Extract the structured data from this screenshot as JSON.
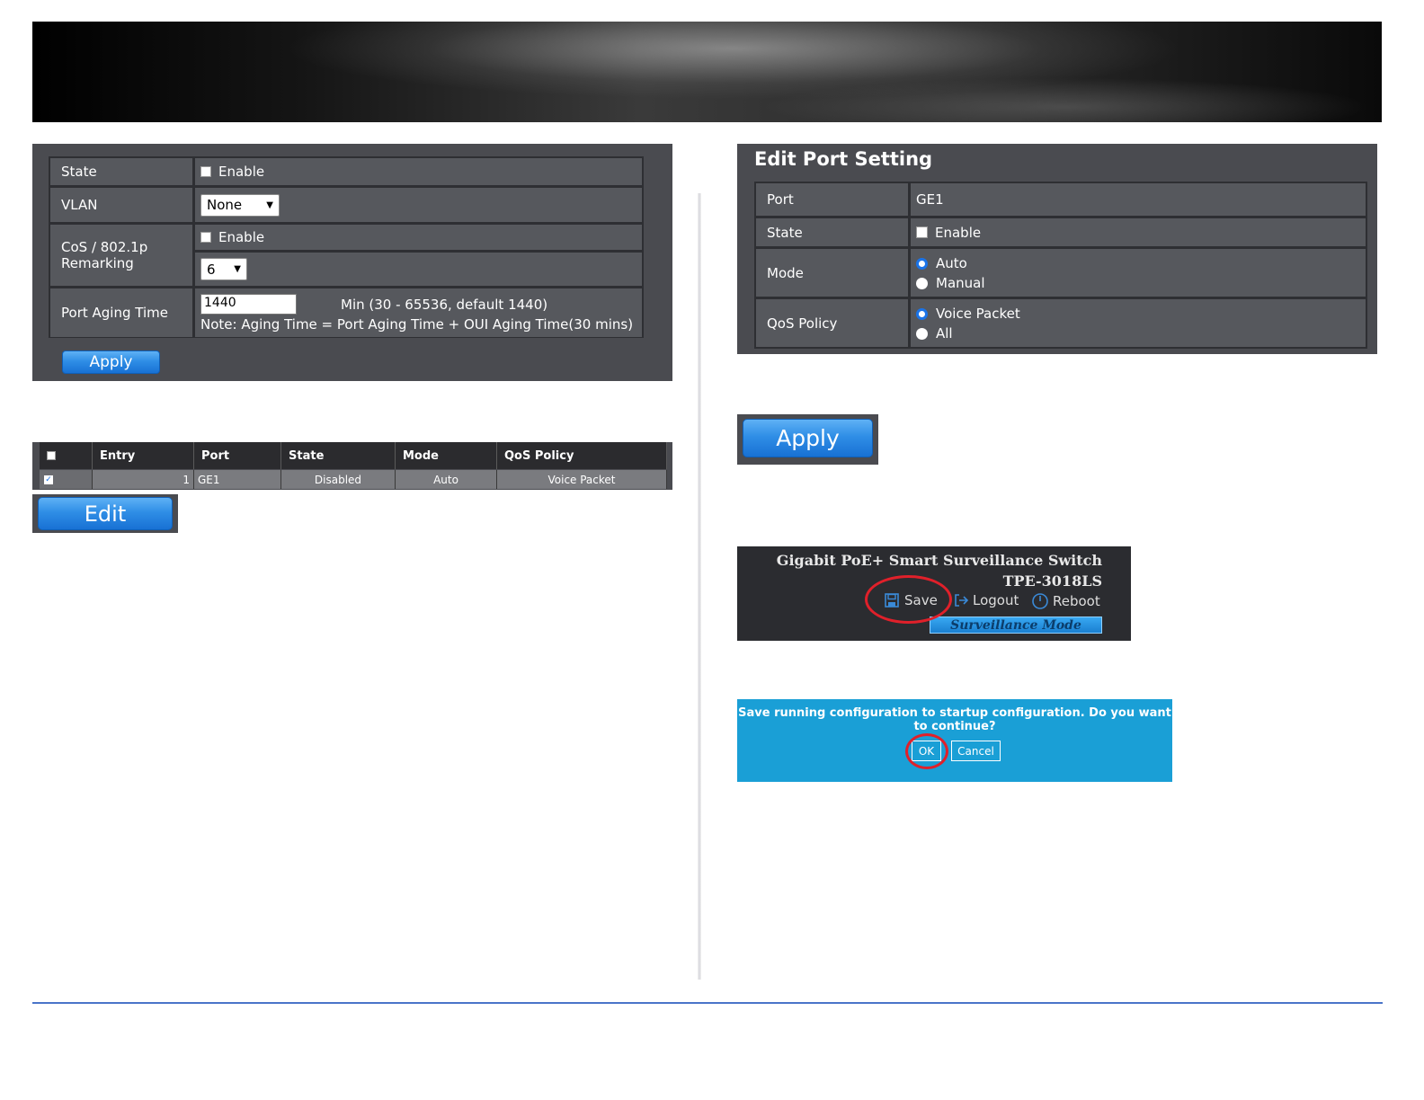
{
  "panel_settings": {
    "state_label": "State",
    "state_enable": "Enable",
    "vlan_label": "VLAN",
    "vlan_value": "None",
    "cos_label_line1": "CoS / 802.1p",
    "cos_label_line2": "Remarking",
    "cos_enable": "Enable",
    "cos_value": "6",
    "aging_label": "Port Aging Time",
    "aging_value": "1440",
    "aging_range": "Min (30 - 65536, default 1440)",
    "aging_note": "Note: Aging Time = Port Aging Time + OUI Aging Time(30 mins)",
    "apply_label": "Apply"
  },
  "port_table": {
    "headers": [
      "Entry",
      "Port",
      "State",
      "Mode",
      "QoS Policy"
    ],
    "rows": [
      {
        "entry": "1",
        "port": "GE1",
        "state": "Disabled",
        "mode": "Auto",
        "qos": "Voice Packet"
      }
    ],
    "edit_label": "Edit"
  },
  "edit_port": {
    "title": "Edit Port Setting",
    "port_label": "Port",
    "port_value": "GE1",
    "state_label": "State",
    "state_enable": "Enable",
    "mode_label": "Mode",
    "mode_auto": "Auto",
    "mode_manual": "Manual",
    "qos_label": "QoS Policy",
    "qos_voice": "Voice Packet",
    "qos_all": "All"
  },
  "apply_large_label": "Apply",
  "header_snippet": {
    "product": "Gigabit PoE+ Smart Surveillance Switch",
    "model": "TPE-3018LS",
    "save": "Save",
    "logout": "Logout",
    "reboot": "Reboot",
    "mode": "Surveillance Mode"
  },
  "confirm_dialog": {
    "message_line1": "Save running configuration to startup configuration. Do you want",
    "message_line2": "to continue?",
    "ok": "OK",
    "cancel": "Cancel"
  },
  "colors": {
    "accent_blue": "#1e88e5",
    "dialog_blue": "#1a9fd6",
    "highlight_red": "#e0202a"
  }
}
